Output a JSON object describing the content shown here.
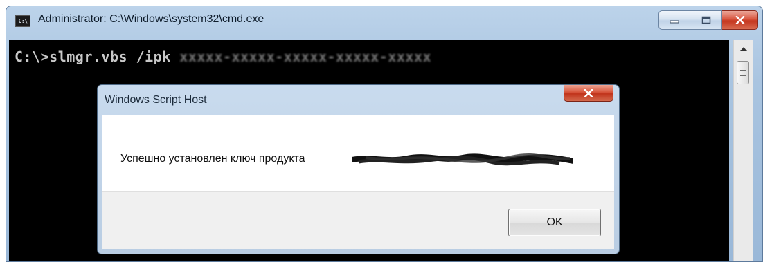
{
  "cmd_window": {
    "title": "Administrator: C:\\Windows\\system32\\cmd.exe",
    "icon": "cmd-icon",
    "icon_text": "C:\\",
    "prompt": "C:\\>slmgr.vbs /ipk",
    "redacted_key": "xxxxx-xxxxx-xxxxx-xxxxx-xxxxx",
    "buttons": {
      "minimize": "minimize-icon",
      "maximize": "maximize-icon",
      "close": "close-icon"
    }
  },
  "dialog": {
    "title": "Windows Script Host",
    "message": "Успешно установлен ключ продукта",
    "ok_label": "OK",
    "close_icon": "close-icon"
  },
  "colors": {
    "close_red": "#c4361e",
    "aero_blue": "#b9cde3",
    "console_bg": "#000000"
  }
}
